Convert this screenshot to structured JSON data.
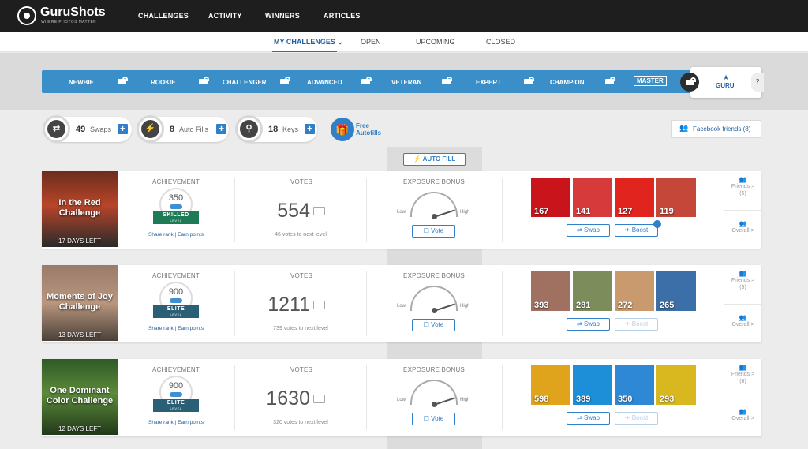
{
  "brand": {
    "name": "GuruShots",
    "tagline": "WHERE PHOTOS MATTER"
  },
  "nav": [
    "CHALLENGES",
    "ACTIVITY",
    "WINNERS",
    "ARTICLES"
  ],
  "subnav": {
    "my_challenges": "MY CHALLENGES",
    "open": "OPEN",
    "upcoming": "UPCOMING",
    "closed": "CLOSED"
  },
  "levels": [
    "NEWBIE",
    "ROOKIE",
    "CHALLENGER",
    "ADVANCED",
    "VETERAN",
    "EXPERT",
    "CHAMPION",
    "MASTER",
    "GURU"
  ],
  "help": "?",
  "resources": {
    "swaps": {
      "count": "49",
      "label": "Swaps"
    },
    "autofills": {
      "count": "8",
      "label": "Auto Fills"
    },
    "keys": {
      "count": "18",
      "label": "Keys"
    },
    "plus": "+",
    "free_autofills_1": "Free",
    "free_autofills_2": "Autofills"
  },
  "facebook_friends": "Facebook friends (8)",
  "auto_fill_button": "AUTO FILL",
  "labels": {
    "achievement": "ACHIEVEMENT",
    "votes": "VOTES",
    "exposure": "EXPOSURE BONUS",
    "low": "Low",
    "high": "High",
    "vote": "Vote",
    "swap": "Swap",
    "boost": "Boost",
    "share_rank": "Share rank",
    "earn_points": "Earn points",
    "level": "LEVEL",
    "overall": "Overall >"
  },
  "challenges": [
    {
      "title_1": "In the Red",
      "title_2": "Challenge",
      "days_left": "17 DAYS LEFT",
      "achievement": "350",
      "level_name": "SKILLED",
      "level_color": "#1f7a56",
      "votes": "554",
      "votes_to_next": "46 votes to next level",
      "exposure": 0.9,
      "boost_enabled": true,
      "friends_1": "Friends >",
      "friends_2": "(5)",
      "photos": [
        "167",
        "141",
        "127",
        "119"
      ],
      "photo_colors": [
        "#c8141a",
        "#d73a3a",
        "#e2241f",
        "#c4473a"
      ]
    },
    {
      "title_1": "Moments of Joy",
      "title_2": "Challenge",
      "days_left": "13 DAYS LEFT",
      "achievement": "900",
      "level_name": "ELITE",
      "level_color": "#2a5f76",
      "votes": "1211",
      "votes_to_next": "739 votes to next level",
      "exposure": 0.9,
      "boost_enabled": false,
      "friends_1": "Friends >",
      "friends_2": "(5)",
      "photos": [
        "393",
        "281",
        "272",
        "265"
      ],
      "photo_colors": [
        "#a07060",
        "#7c8c5a",
        "#c99a6d",
        "#3c6fa8"
      ]
    },
    {
      "title_1": "One Dominant",
      "title_2": "Color Challenge",
      "days_left": "12 DAYS LEFT",
      "achievement": "900",
      "level_name": "ELITE",
      "level_color": "#2a5f76",
      "votes": "1630",
      "votes_to_next": "320 votes to next level",
      "exposure": 0.9,
      "boost_enabled": false,
      "friends_1": "Friends >",
      "friends_2": "(6)",
      "photos": [
        "598",
        "389",
        "350",
        "293"
      ],
      "photo_colors": [
        "#e0a31c",
        "#1c8fd8",
        "#2e88d6",
        "#d9b81f"
      ]
    }
  ]
}
